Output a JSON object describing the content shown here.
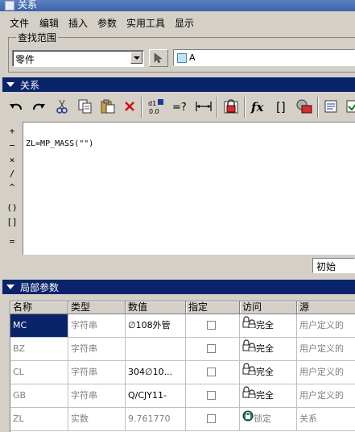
{
  "window": {
    "title": "关系"
  },
  "menu": [
    "文件",
    "编辑",
    "插入",
    "参数",
    "实用工具",
    "显示"
  ],
  "search": {
    "title": "查找范围",
    "scope_value": "零件",
    "ref_value": "A"
  },
  "relations": {
    "title": "关系",
    "editor_text": "ZL=MP_MASS(\"\")",
    "operators": [
      "+",
      "−",
      "×",
      "/",
      "^",
      "()",
      "[]",
      "="
    ],
    "status_value": "初始"
  },
  "local_params": {
    "title": "局部参数",
    "columns": [
      "名称",
      "类型",
      "数值",
      "指定",
      "访问",
      "源"
    ],
    "rows": [
      {
        "name": "MC",
        "type": "字符串",
        "value": "∅108外管",
        "access": "完全",
        "source": "用户定义的"
      },
      {
        "name": "BZ",
        "type": "字符串",
        "value": "",
        "access": "完全",
        "source": "用户定义的"
      },
      {
        "name": "CL",
        "type": "字符串",
        "value": "304∅10...",
        "access": "完全",
        "source": "用户定义的"
      },
      {
        "name": "GB",
        "type": "字符串",
        "value": "Q/CJY11-",
        "access": "完全",
        "source": "用户定义的"
      },
      {
        "name": "ZL",
        "type": "实数",
        "value": "9.761770",
        "access": "锁定",
        "source": "关系"
      }
    ]
  },
  "colors": {
    "section_bar": "#0a246a",
    "window_bg": "#d4d0c8",
    "selection": "#0a246a"
  }
}
